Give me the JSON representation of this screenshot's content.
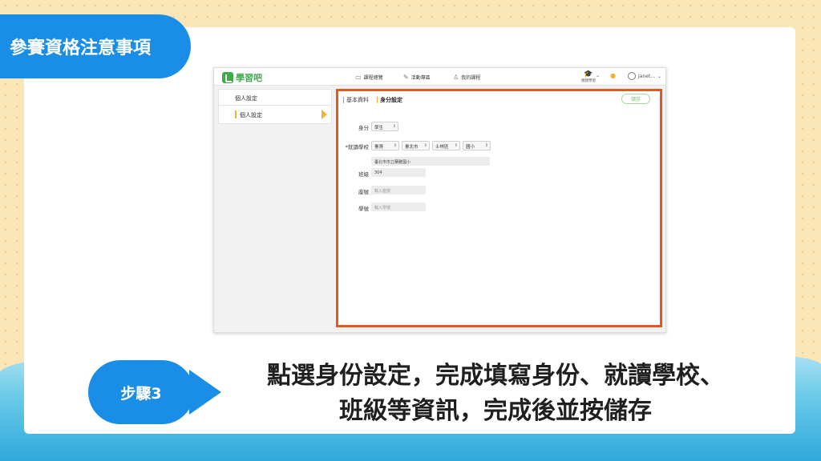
{
  "slide_title": "參賽資格注意事項",
  "app": {
    "logo_text": "學習吧",
    "nav": [
      {
        "label": "課程總覽",
        "icon": "book-icon"
      },
      {
        "label": "活動專區",
        "icon": "megaphone-icon"
      },
      {
        "label": "我的課程",
        "icon": "person-course-icon"
      }
    ],
    "mode_label": "偶我學習",
    "user_name": "Janet..."
  },
  "sidebar": {
    "header": "個人設定",
    "items": [
      {
        "label": "個人設定"
      }
    ]
  },
  "panel": {
    "tabs": [
      {
        "label": "基本資料"
      },
      {
        "label": "身分設定"
      }
    ],
    "save_label": "儲存",
    "identity_label": "身分",
    "identity_value": "學生",
    "school_label": "*就讀學校",
    "school_selects": [
      "臺灣",
      "臺北市",
      "士林區",
      "國小"
    ],
    "school_name": "臺北市市立蘭雅國小",
    "class_label": "班級",
    "class_value": "304",
    "seat_label": "座號",
    "seat_placeholder": "輸入座號",
    "student_id_label": "學號",
    "student_id_placeholder": "輸入學號"
  },
  "step": {
    "label": "步驟3",
    "instruction_line1": "點選身份設定，完成填寫身份、就讀學校、",
    "instruction_line2": "班級等資訊，完成後並按儲存"
  },
  "colors": {
    "accent_blue": "#1a8de6",
    "highlight_orange": "#e25a1f",
    "brand_green": "#3dab4a"
  }
}
